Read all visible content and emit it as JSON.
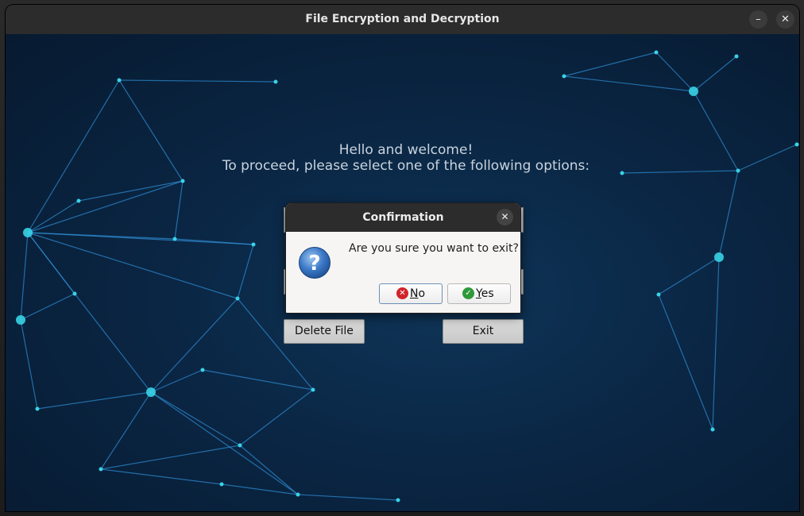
{
  "window": {
    "title": "File Encryption and Decryption",
    "minimize_glyph": "–",
    "close_glyph": "✕"
  },
  "main": {
    "welcome_line1": "Hello and welcome!",
    "welcome_line2": "To proceed, please select one of the following options:",
    "delete_file_label": "Delete File",
    "exit_label": "Exit"
  },
  "dialog": {
    "title": "Confirmation",
    "close_glyph": "✕",
    "message": "Are you sure you want to exit?",
    "icon": "question-icon",
    "no_label_mnemonic": "N",
    "no_label_rest": "o",
    "yes_label_mnemonic": "Y",
    "yes_label_rest": "es"
  },
  "colors": {
    "background": "#0a2644",
    "network_line": "#2f8fd6",
    "network_node": "#39d3e6",
    "no_icon": "#d2232a",
    "yes_icon": "#2e9a3a"
  }
}
